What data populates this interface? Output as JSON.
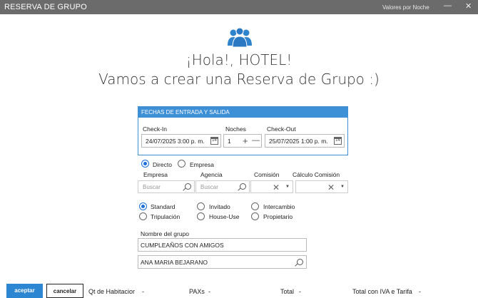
{
  "window": {
    "title": "RESERVA DE GRUPO",
    "valores_link": "Valores por Noche",
    "minimize": "—",
    "close": "✕"
  },
  "greeting": {
    "line1": "¡Hola!, HOTEL!",
    "line2": "Vamos a crear una Reserva de Grupo :)"
  },
  "fechas": {
    "header": "FECHAS DE ENTRADA Y SALIDA",
    "checkin_label": "Check-In",
    "checkin_value": "24/07/2025 3:00 p. m.",
    "noches_label": "Noches",
    "noches_value": "1",
    "checkout_label": "Check-Out",
    "checkout_value": "25/07/2025 1:00 p. m.",
    "cal_glyph": "14",
    "plus": "+",
    "minus": "—"
  },
  "canal": {
    "directo": "Directo",
    "empresa": "Empresa",
    "selected": "Directo"
  },
  "filters": {
    "empresa_label": "Empresa",
    "agencia_label": "Agencia",
    "comision_label": "Comisión",
    "calculo_label": "Cálculo Comisión",
    "empresa_placeholder": "Buscar",
    "agencia_placeholder": "Buscar",
    "clear_glyph": "✕",
    "dropdown_glyph": "▼"
  },
  "tipo": {
    "standard": "Standard",
    "invitado": "Invitado",
    "intercambio": "Intercambio",
    "tripulacion": "Tripulación",
    "house_use": "House-Use",
    "propietario": "Propietario",
    "selected": "Standard"
  },
  "grupo": {
    "nombre_label": "Nombre del grupo",
    "nombre_value": "CUMPLEAÑOS CON AMIGOS",
    "titular_value": "ANA MARIA BEJARANO"
  },
  "footer": {
    "aceptar": "aceptar",
    "cancelar": "cancelar",
    "qt_label": "Qt de Habitacior",
    "qt_value": "-",
    "paxs_label": "PAXs",
    "paxs_value": "-",
    "total_label": "Total",
    "total_value": "-",
    "total_iva_label": "Total con IVA e Tarifa",
    "total_iva_value": "-"
  },
  "colors": {
    "accent": "#2d86d2",
    "titlebar": "#6b6b6b",
    "panel_border": "#3d8fd6"
  }
}
